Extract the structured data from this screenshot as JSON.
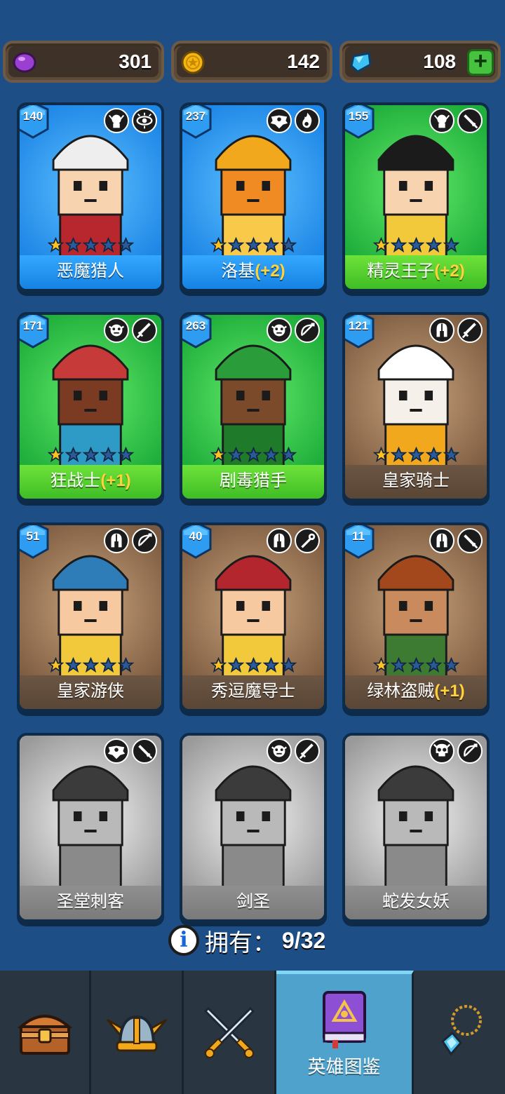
{
  "currency": {
    "purple_gem": {
      "value": "301",
      "icon": "purple-gem-icon"
    },
    "gold_coin": {
      "value": "142",
      "icon": "gold-coin-icon"
    },
    "diamond": {
      "value": "108",
      "icon": "diamond-icon",
      "add_label": "+"
    }
  },
  "heroes": [
    {
      "name": "恶魔猎人",
      "bonus": "",
      "level": "140",
      "stars": 1,
      "color": "blue",
      "icons": [
        "elf-head-icon",
        "eye-icon"
      ]
    },
    {
      "name": "洛基",
      "bonus": "(+2)",
      "level": "237",
      "stars": 1,
      "color": "blue",
      "icons": [
        "wing-icon",
        "flame-icon"
      ]
    },
    {
      "name": "精灵王子",
      "bonus": "(+2)",
      "level": "155",
      "stars": 1,
      "color": "green",
      "icons": [
        "elf-head-icon",
        "dagger-icon"
      ]
    },
    {
      "name": "狂战士",
      "bonus": "(+1)",
      "level": "171",
      "stars": 1,
      "color": "green",
      "icons": [
        "orc-head-icon",
        "sword-icon"
      ]
    },
    {
      "name": "剧毒猎手",
      "bonus": "",
      "level": "263",
      "stars": 1,
      "color": "green",
      "icons": [
        "orc-head-icon",
        "bow-icon"
      ]
    },
    {
      "name": "皇家骑士",
      "bonus": "",
      "level": "121",
      "stars": 1,
      "color": "brown",
      "icons": [
        "helmet-icon",
        "sword-icon"
      ]
    },
    {
      "name": "皇家游侠",
      "bonus": "",
      "level": "51",
      "stars": 1,
      "color": "brown",
      "icons": [
        "helmet-icon",
        "bow-icon"
      ]
    },
    {
      "name": "秀逗魔导士",
      "bonus": "",
      "level": "40",
      "stars": 1,
      "color": "brown",
      "icons": [
        "helmet-icon",
        "staff-icon"
      ]
    },
    {
      "name": "绿林盗贼",
      "bonus": "(+1)",
      "level": "11",
      "stars": 1,
      "color": "brown",
      "icons": [
        "helmet-icon",
        "dagger-icon"
      ]
    },
    {
      "name": "圣堂刺客",
      "bonus": "",
      "level": "",
      "stars": 0,
      "color": "gray",
      "icons": [
        "wing-icon",
        "dagger-icon"
      ]
    },
    {
      "name": "剑圣",
      "bonus": "",
      "level": "",
      "stars": 0,
      "color": "gray",
      "icons": [
        "orc-head-icon",
        "sword-icon"
      ]
    },
    {
      "name": "蛇发女妖",
      "bonus": "",
      "level": "",
      "stars": 0,
      "color": "gray",
      "icons": [
        "skull-icon",
        "bow-icon"
      ]
    }
  ],
  "owned": {
    "label": "拥有：",
    "count": "9/32"
  },
  "nav": [
    {
      "icon": "treasure-chest-icon",
      "label": ""
    },
    {
      "icon": "viking-helmet-icon",
      "label": ""
    },
    {
      "icon": "crossed-swords-icon",
      "label": ""
    },
    {
      "icon": "hero-book-icon",
      "label": "英雄图鉴"
    },
    {
      "icon": "amulet-icon",
      "label": ""
    }
  ],
  "colors": {
    "background": "#1d4f86",
    "blue_card": "#1e86e6",
    "green_card": "#1fae3b",
    "brown_card": "#7c5a3f",
    "gray_card": "#9a9a9a",
    "bonus": "#ffd23a",
    "active_tab": "#4fa2cc"
  }
}
